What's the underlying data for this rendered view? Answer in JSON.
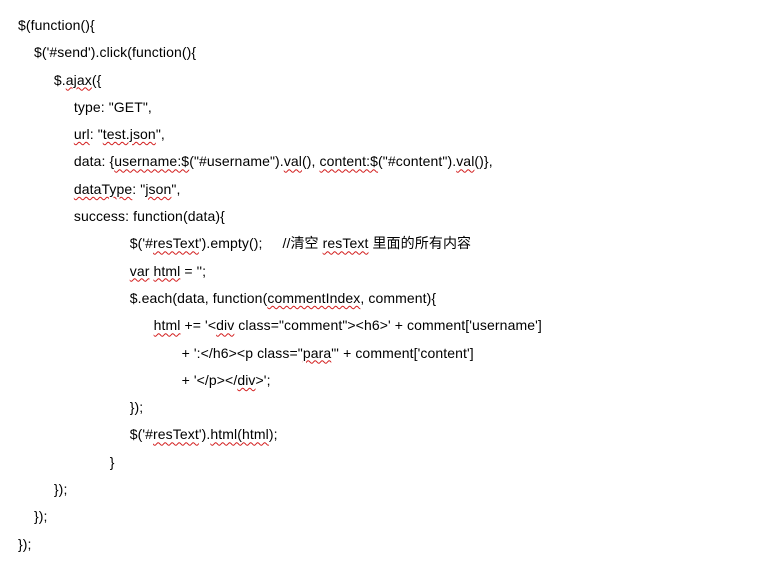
{
  "code": {
    "l1p1": "$(function(){",
    "l2p1": "    $('#send').click(function(){",
    "l3p1": "         $.",
    "l3u1": "ajax",
    "l3p2": "({",
    "l4p1": "              type: \"GET\",",
    "l5p1": "              ",
    "l5u1": "url",
    "l5p2": ": \"",
    "l5u2": "test.json",
    "l5p3": "\",",
    "l6p1": "              data: {",
    "l6u1": "username:$",
    "l6p2": "(\"#username\").",
    "l6u2": "val",
    "l6p3": "(), ",
    "l6u3": "content:$",
    "l6p4": "(\"#content\").",
    "l6u4": "val",
    "l6p5": "()},",
    "l7p1": "              ",
    "l7u1": "dataType",
    "l7p2": ": \"",
    "l7u2": "json",
    "l7p3": "\",",
    "l8p1": "              success: function(data){",
    "l9p1": "                            $('#",
    "l9u1": "resText",
    "l9p2": "').empty();     //清空 ",
    "l9u2": "resText",
    "l9p3": " 里面的所有内容",
    "l10p1": "                            ",
    "l10u1": "var",
    "l10p2": " ",
    "l10u2": "html",
    "l10p3": " = '';",
    "l11p1": "                            $.each(data, function(",
    "l11u1": "commentIndex",
    "l11p2": ", comment){",
    "l12p1": "                                  ",
    "l12u1": "html",
    "l12p2": " += '<",
    "l12u2": "div",
    "l12p3": " class=\"comment\"><h6>' + comment['username']",
    "l13p1": "                                         + ':</h6><p class=\"",
    "l13u1": "para",
    "l13p2": "\"' + comment['content']",
    "l14p1": "                                         + '</p></",
    "l14u1": "div",
    "l14p2": ">';",
    "l15p1": "                            });",
    "l16p1": "                            $('#",
    "l16u1": "resText",
    "l16p2": "').",
    "l16u2": "html(html",
    "l16p3": ");",
    "l17p1": "                       }",
    "l18p1": "         });",
    "l19p1": "    });",
    "l20p1": "});"
  }
}
